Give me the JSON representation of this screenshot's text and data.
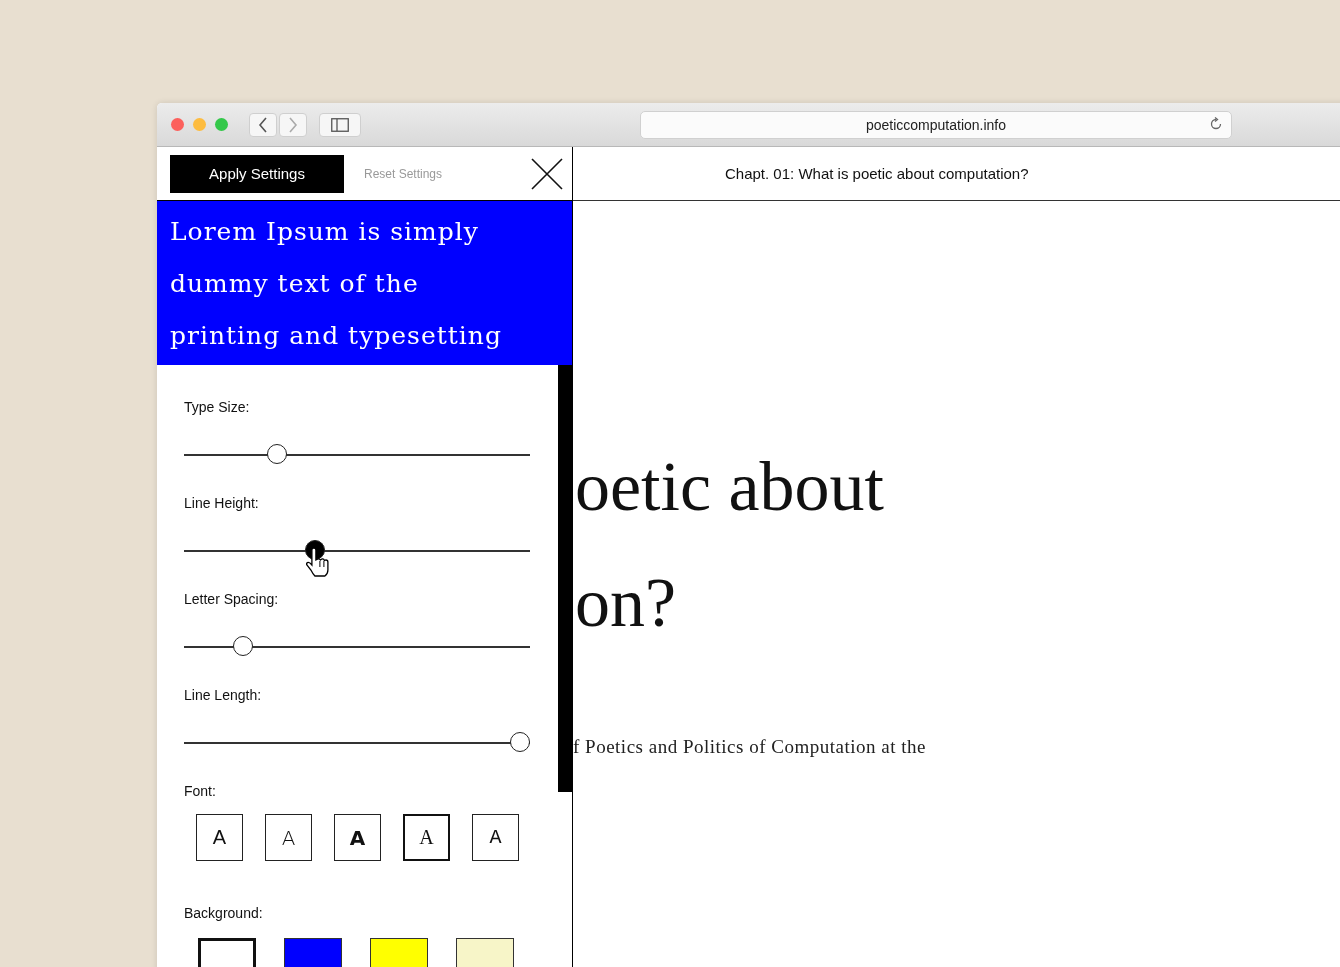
{
  "browser": {
    "url": "poeticcomputation.info"
  },
  "panel": {
    "apply_button": "Apply Settings",
    "reset_button": "Reset Settings",
    "preview": "Lorem Ipsum is simply dummy text of the printing and typesetting",
    "sliders": [
      {
        "label": "Type Size:",
        "level": 0.27,
        "active": false
      },
      {
        "label": "Line Height:",
        "level": 0.38,
        "active": true
      },
      {
        "label": "Letter Spacing:",
        "level": 0.17,
        "active": false
      },
      {
        "label": "Line Length:",
        "level": 0.97,
        "active": false
      }
    ],
    "font_label": "Font:",
    "fonts": [
      {
        "label": "A",
        "kind": "sans",
        "selected": false
      },
      {
        "label": "A",
        "kind": "rounded",
        "selected": false
      },
      {
        "label": "A",
        "kind": "wide",
        "selected": false
      },
      {
        "label": "A",
        "kind": "serif",
        "selected": true
      },
      {
        "label": "A",
        "kind": "mono",
        "selected": false
      }
    ],
    "background_label": "Background:",
    "backgrounds": [
      {
        "color": "#ffffff",
        "selected": true
      },
      {
        "color": "#0000ff",
        "selected": false
      },
      {
        "color": "#ffff00",
        "selected": false
      },
      {
        "color": "#f7f5c8",
        "selected": false
      }
    ]
  },
  "article": {
    "chapter_title": "Chapt. 01: What is poetic about computation?",
    "heading_lines": [
      "oetic about",
      "on?"
    ],
    "body_line": "f Poetics and Politics of Computation at the"
  }
}
